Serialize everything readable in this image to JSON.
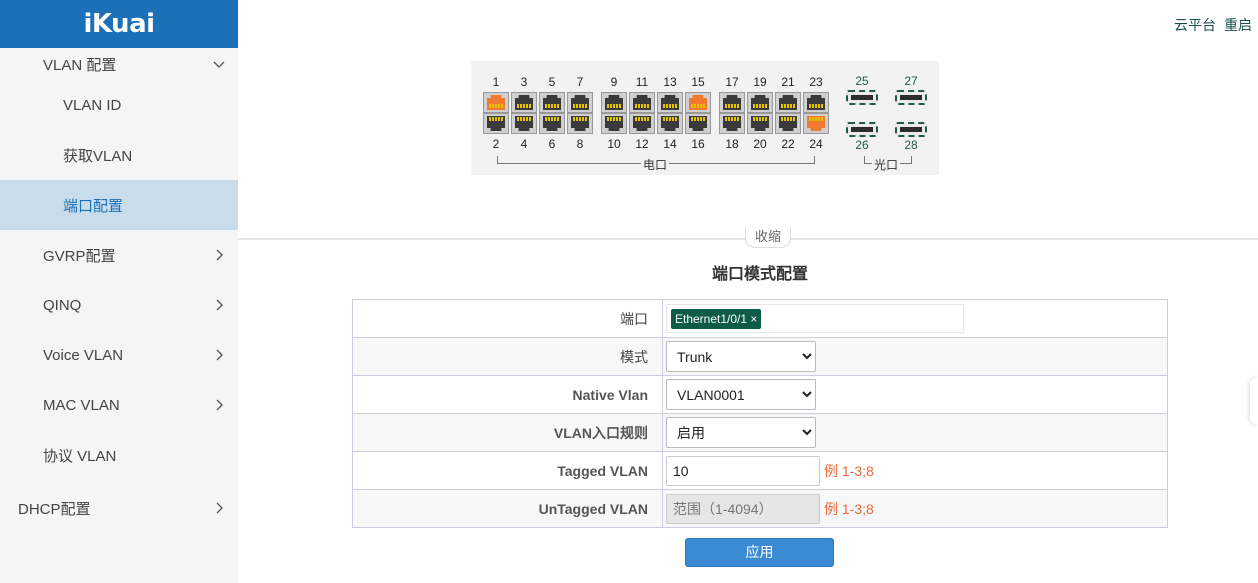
{
  "brand": {
    "logo_text": "iKuai"
  },
  "top_links": {
    "cloud": "云平台",
    "restart": "重启"
  },
  "sidebar": {
    "items": [
      {
        "label": "VLAN 配置",
        "level": 1,
        "chevron": "down"
      },
      {
        "label": "VLAN ID",
        "level": 2
      },
      {
        "label": "获取VLAN",
        "level": 2
      },
      {
        "label": "端口配置",
        "level": 2,
        "active": true
      },
      {
        "label": "GVRP配置",
        "level": 1,
        "chevron": "right"
      },
      {
        "label": "QINQ",
        "level": 1,
        "chevron": "right"
      },
      {
        "label": "Voice VLAN",
        "level": 1,
        "chevron": "right"
      },
      {
        "label": "MAC VLAN",
        "level": 1,
        "chevron": "right"
      },
      {
        "label": "协议 VLAN",
        "level": 1
      },
      {
        "label": "DHCP配置",
        "level": 0,
        "chevron": "right"
      }
    ]
  },
  "switch": {
    "electric_label": "电口",
    "optical_label": "光口",
    "top_ports": [
      "1",
      "3",
      "5",
      "7",
      "9",
      "11",
      "13",
      "15",
      "17",
      "19",
      "21",
      "23"
    ],
    "bottom_ports": [
      "2",
      "4",
      "6",
      "8",
      "10",
      "12",
      "14",
      "16",
      "18",
      "20",
      "22",
      "24"
    ],
    "optical_top": [
      "25",
      "27"
    ],
    "optical_bottom": [
      "26",
      "28"
    ],
    "active_ports": [
      "1",
      "15",
      "24"
    ]
  },
  "collapse_label": "收缩",
  "form": {
    "title": "端口模式配置",
    "port_label": "端口",
    "port_tag": "Ethernet1/0/1 ×",
    "mode_label": "模式",
    "mode_value": "Trunk",
    "native_label": "Native Vlan",
    "native_value": "VLAN0001",
    "ingress_label": "VLAN入口规则",
    "ingress_value": "启用",
    "tagged_label": "Tagged VLAN",
    "tagged_value": "10",
    "tagged_hint": "例 1-3;8",
    "untagged_label": "UnTagged VLAN",
    "untagged_placeholder": "范围（1-4094）",
    "untagged_hint": "例 1-3;8",
    "apply_label": "应用"
  },
  "colors": {
    "brand": "#1c70b7",
    "active_bg": "#c9dcec",
    "tag": "#0e5b49",
    "hint": "#e8693a",
    "apply": "#3a8ad4",
    "port_active": "#f07a30"
  }
}
